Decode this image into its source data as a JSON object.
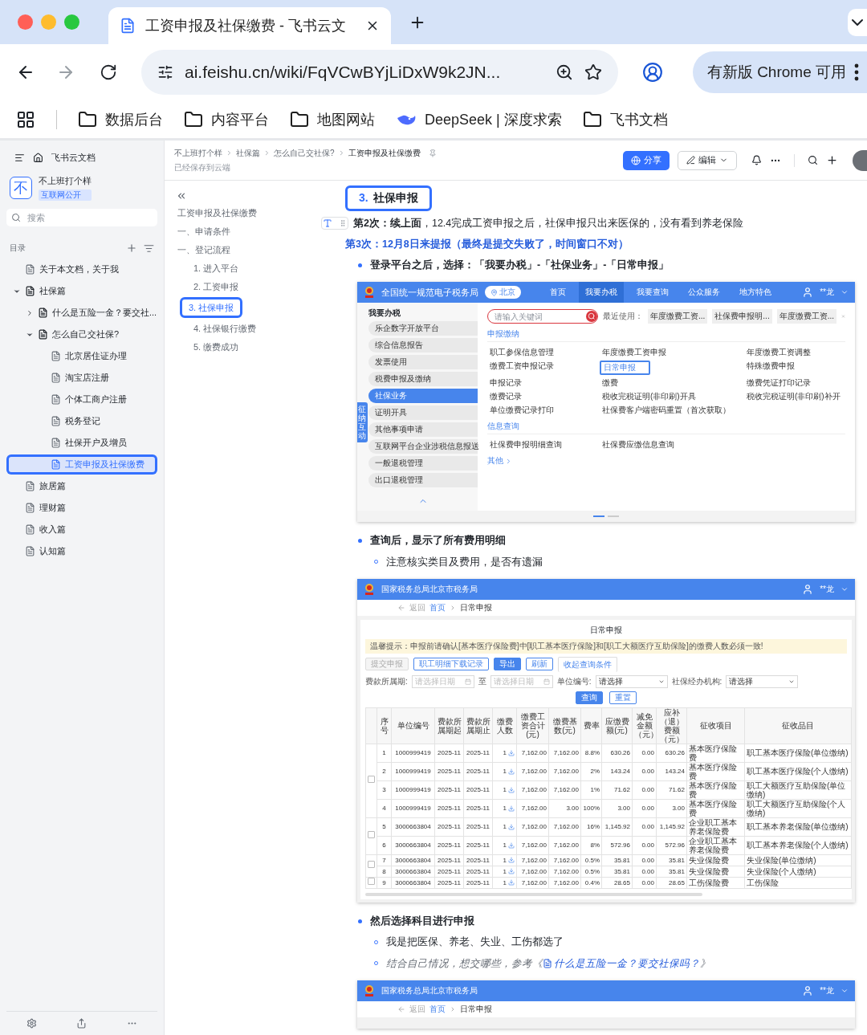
{
  "browser": {
    "tab_title": "工资申报及社保缴费 - 飞书云文",
    "address": "ai.feishu.cn/wiki/FqVCwBYjLiDxW9k2JN...",
    "update_notice": "有新版 Chrome 可用",
    "bookmarks": [
      {
        "label": "数据后台",
        "kind": "folder"
      },
      {
        "label": "内容平台",
        "kind": "folder"
      },
      {
        "label": "地图网站",
        "kind": "folder"
      },
      {
        "label": "DeepSeek | 深度求索",
        "kind": "site"
      },
      {
        "label": "飞书文档",
        "kind": "folder"
      }
    ]
  },
  "sidebar": {
    "home_label": "飞书云文档",
    "space": {
      "avatar": "不",
      "name": "不上班打个样",
      "badge": "互联网公开"
    },
    "search": {
      "placeholder": "搜索"
    },
    "toc_label": "目录",
    "tree": [
      {
        "label": "关于本文档，关于我",
        "kind": "page",
        "selected": false,
        "annotated": false
      },
      {
        "label": "社保篇",
        "kind": "group",
        "expanded": true,
        "selected": false,
        "annotated": false,
        "children": [
          {
            "label": "什么是五险一金？要交社...",
            "kind": "group",
            "expanded": false,
            "selected": false,
            "annotated": false
          },
          {
            "label": "怎么自己交社保?",
            "kind": "group",
            "expanded": true,
            "selected": false,
            "annotated": false,
            "children": [
              {
                "label": "北京居住证办理",
                "kind": "page",
                "selected": false,
                "annotated": false
              },
              {
                "label": "淘宝店注册",
                "kind": "page",
                "selected": false,
                "annotated": false
              },
              {
                "label": "个体工商户注册",
                "kind": "page",
                "selected": false,
                "annotated": false
              },
              {
                "label": "税务登记",
                "kind": "page",
                "selected": false,
                "annotated": false
              },
              {
                "label": "社保开户及增员",
                "kind": "page",
                "selected": false,
                "annotated": false
              },
              {
                "label": "工资申报及社保缴费",
                "kind": "page",
                "selected": true,
                "annotated": true
              }
            ]
          }
        ]
      },
      {
        "label": "旅居篇",
        "kind": "page",
        "selected": false,
        "annotated": false
      },
      {
        "label": "理财篇",
        "kind": "page",
        "selected": false,
        "annotated": false
      },
      {
        "label": "收入篇",
        "kind": "page",
        "selected": false,
        "annotated": false
      },
      {
        "label": "认知篇",
        "kind": "page",
        "selected": false,
        "annotated": false
      }
    ]
  },
  "header": {
    "breadcrumbs": [
      "不上班打个样",
      "社保篇",
      "怎么自己交社保?",
      "工资申报及社保缴费"
    ],
    "save_status": "已经保存到云端",
    "share": "分享",
    "edit": "编辑"
  },
  "outline": {
    "title": "工资申报及社保缴费",
    "items": [
      {
        "label": "一、申请条件",
        "selected": false,
        "annotated": false
      },
      {
        "label": "一、登记流程",
        "selected": false,
        "annotated": false,
        "children": [
          {
            "label": "1. 进入平台",
            "selected": false,
            "annotated": false
          },
          {
            "label": "2. 工资申报",
            "selected": false,
            "annotated": false
          },
          {
            "label": "3. 社保申报",
            "selected": true,
            "annotated": true
          },
          {
            "label": "4. 社保银行缴费",
            "selected": false,
            "annotated": false
          },
          {
            "label": "5. 缴费成功",
            "selected": false,
            "annotated": false
          }
        ]
      }
    ]
  },
  "document": [
    {
      "kind": "heading",
      "number": "3.",
      "text": "社保申报",
      "annotated": true
    },
    {
      "kind": "paragraph",
      "text": "**第2次：续上面**，12.4完成工资申报之后，社保申报只出来医保的，没有看到养老保险"
    },
    {
      "kind": "highlight",
      "text": "第3次：12月8日来提报（最终是提交失败了，时间窗口不对）"
    },
    {
      "kind": "bullet",
      "text": "登录平台之后，选择：「我要办税」-「社保业务」-「日常申报」"
    },
    {
      "kind": "portal",
      "title": "全国统一规范电子税务局",
      "region": "北京",
      "user": "**龙",
      "nav": [
        {
          "label": "首页",
          "selected": false
        },
        {
          "label": "我要办税",
          "selected": true
        },
        {
          "label": "我要查询",
          "selected": false
        },
        {
          "label": "公众服务",
          "selected": false
        },
        {
          "label": "地方特色",
          "selected": false
        }
      ],
      "menu_title": "我要办税",
      "helper": "征纳互动",
      "menu": [
        {
          "label": "乐企数字开放平台",
          "selected": false
        },
        {
          "label": "综合信息报告",
          "selected": false
        },
        {
          "label": "发票使用",
          "selected": false
        },
        {
          "label": "税费申报及缴纳",
          "selected": false
        },
        {
          "label": "社保业务",
          "selected": true
        },
        {
          "label": "证明开具",
          "selected": false
        },
        {
          "label": "其他事项申请",
          "selected": false
        },
        {
          "label": "互联网平台企业涉税信息报送",
          "selected": false
        },
        {
          "label": "一般退税管理",
          "selected": false
        },
        {
          "label": "出口退税管理",
          "selected": false
        }
      ],
      "search": {
        "placeholder": "请输入关键词"
      },
      "recent_label": "最近使用：",
      "recent": [
        "年度缴费工资...",
        "社保费申报明...",
        "年度缴费工资..."
      ],
      "sections": [
        {
          "title": "申报缴纳",
          "items": [
            {
              "label": "职工参保信息管理",
              "annotated": false
            },
            {
              "label": "年度缴费工资申报",
              "annotated": false
            },
            {
              "label": "年度缴费工资调整",
              "annotated": false
            },
            {
              "label": "缴费工资申报记录",
              "annotated": false
            },
            {
              "label": "日常申报",
              "annotated": true
            },
            {
              "label": "特殊缴费申报",
              "annotated": false
            },
            {
              "label": "申报记录",
              "annotated": false
            },
            {
              "label": "缴费",
              "annotated": false
            },
            {
              "label": "缴费凭证打印记录",
              "annotated": false
            },
            {
              "label": "缴费记录",
              "annotated": false
            },
            {
              "label": "税收完税证明(非印刷)开具",
              "annotated": false
            },
            {
              "label": "税收完税证明(非印刷)补开",
              "annotated": false
            },
            {
              "label": "单位缴费记录打印",
              "annotated": false
            },
            {
              "label": "社保费客户端密码重置（首次获取）",
              "annotated": false
            }
          ]
        },
        {
          "title": "信息查询",
          "items": [
            {
              "label": "社保费申报明细查询",
              "annotated": false
            },
            {
              "label": "社保费应缴信息查询",
              "annotated": false
            }
          ]
        }
      ],
      "more": "其他",
      "pager": [
        {
          "selected": true
        },
        {
          "selected": false
        }
      ]
    },
    {
      "kind": "bullet",
      "text": "查询后，显示了所有费用明细",
      "children": [
        {
          "kind": "text",
          "text": "注意核实类目及费用，是否有遗漏"
        }
      ]
    },
    {
      "kind": "declaration",
      "agency": "国家税务总局北京市税务局",
      "user": "**龙",
      "back": "返回",
      "crumbs": [
        "首页",
        "日常申报"
      ],
      "title": "日常申报",
      "notice": "温馨提示：申报前请确认[基本医疗保险费]中[职工基本医疗保险]和[职工大额医疗互助保险]的缴费人数必须一致!",
      "actions": [
        {
          "label": "提交申报",
          "kind": "disabled"
        },
        {
          "label": "职工明细下载记录",
          "kind": "outline"
        },
        {
          "label": "导出",
          "kind": "primary"
        },
        {
          "label": "刷新",
          "kind": "outline"
        },
        {
          "label": "收起查询条件",
          "kind": "tab"
        }
      ],
      "filters": [
        {
          "kind": "date_range",
          "label": "费款所属期:",
          "placeholders": [
            "请选择日期",
            "请选择日期"
          ],
          "joiner": "至"
        },
        {
          "kind": "select",
          "label": "单位编号:",
          "value": "请选择"
        },
        {
          "kind": "select",
          "label": "社保经办机构:",
          "value": "请选择"
        }
      ],
      "filter_buttons": [
        "查询",
        "重置"
      ],
      "columns": [
        "序号",
        "单位编号",
        "费款所属期起",
        "费款所属期止",
        "缴费人数",
        "缴费工资合计(元)",
        "缴费基数(元)",
        "费率",
        "应缴费额(元)",
        "减免金额（元）",
        "应补（退）费额（元）",
        "征收项目",
        "征收品目"
      ],
      "groups": [
        {
          "checked": false,
          "rows": [
            [
              "1",
              "1000999419",
              "2025-11",
              "2025-11",
              "1",
              "7,162.00",
              "7,162.00",
              "8.8%",
              "630.26",
              "0.00",
              "630.26",
              "基本医疗保险费",
              "职工基本医疗保险(单位缴纳)"
            ],
            [
              "2",
              "1000999419",
              "2025-11",
              "2025-11",
              "1",
              "7,162.00",
              "7,162.00",
              "2%",
              "143.24",
              "0.00",
              "143.24",
              "基本医疗保险费",
              "职工基本医疗保险(个人缴纳)"
            ],
            [
              "3",
              "1000999419",
              "2025-11",
              "2025-11",
              "1",
              "7,162.00",
              "7,162.00",
              "1%",
              "71.62",
              "0.00",
              "71.62",
              "基本医疗保险费",
              "职工大额医疗互助保险(单位缴纳)"
            ],
            [
              "4",
              "1000999419",
              "2025-11",
              "2025-11",
              "1",
              "7,162.00",
              "3.00",
              "100%",
              "3.00",
              "0.00",
              "3.00",
              "基本医疗保险费",
              "职工大额医疗互助保险(个人缴纳)"
            ]
          ]
        },
        {
          "checked": false,
          "rows": [
            [
              "5",
              "3000663804",
              "2025-11",
              "2025-11",
              "1",
              "7,162.00",
              "7,162.00",
              "16%",
              "1,145.92",
              "0.00",
              "1,145.92",
              "企业职工基本养老保险费",
              "职工基本养老保险(单位缴纳)"
            ],
            [
              "6",
              "3000663804",
              "2025-11",
              "2025-11",
              "1",
              "7,162.00",
              "7,162.00",
              "8%",
              "572.96",
              "0.00",
              "572.96",
              "企业职工基本养老保险费",
              "职工基本养老保险(个人缴纳)"
            ]
          ]
        },
        {
          "checked": false,
          "rows": [
            [
              "7",
              "3000663804",
              "2025-11",
              "2025-11",
              "1",
              "7,162.00",
              "7,162.00",
              "0.5%",
              "35.81",
              "0.00",
              "35.81",
              "失业保险费",
              "失业保险(单位缴纳)"
            ],
            [
              "8",
              "3000663804",
              "2025-11",
              "2025-11",
              "1",
              "7,162.00",
              "7,162.00",
              "0.5%",
              "35.81",
              "0.00",
              "35.81",
              "失业保险费",
              "失业保险(个人缴纳)"
            ]
          ]
        },
        {
          "checked": false,
          "rows": [
            [
              "9",
              "3000663804",
              "2025-11",
              "2025-11",
              "1",
              "7,162.00",
              "7,162.00",
              "0.4%",
              "28.65",
              "0.00",
              "28.65",
              "工伤保险费",
              "工伤保险"
            ]
          ]
        }
      ]
    },
    {
      "kind": "bullet",
      "text": "然后选择科目进行申报",
      "children": [
        {
          "kind": "text",
          "text": "我是把医保、养老、失业、工伤都选了"
        },
        {
          "kind": "reference",
          "before": "结合自己情况，想交哪些，参考《",
          "link": "什么是五险一金？要交社保吗？",
          "after": "》"
        }
      ]
    },
    {
      "kind": "declaration_header",
      "agency": "国家税务总局北京市税务局",
      "user": "**龙",
      "back": "返回",
      "crumbs": [
        "首页",
        "日常申报"
      ]
    }
  ]
}
